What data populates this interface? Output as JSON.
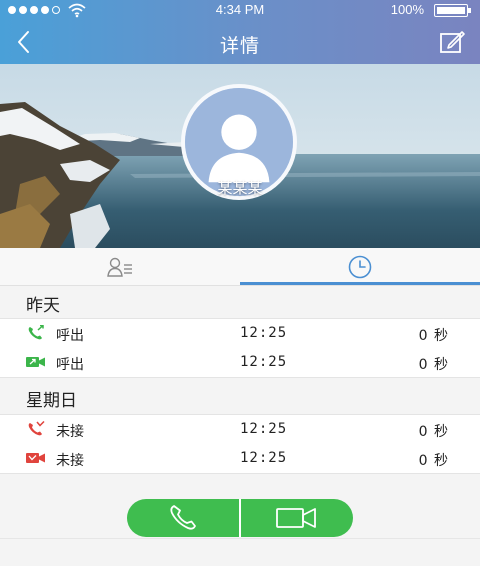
{
  "status_bar": {
    "time": "4:34 PM",
    "battery_text": "100%",
    "signal_bars_filled": 4,
    "signal_bars_total": 5
  },
  "nav": {
    "title": "详情",
    "back_icon": "chevron-left-icon",
    "edit_icon": "edit-icon"
  },
  "contact": {
    "name": "某某某"
  },
  "tabs": [
    {
      "id": "contact",
      "icon": "contact-card-icon",
      "active": false
    },
    {
      "id": "history",
      "icon": "clock-icon",
      "active": true
    }
  ],
  "sections": [
    {
      "title": "昨天",
      "items": [
        {
          "icon": "outgoing-call-icon",
          "type": "呼出",
          "time": "12:25",
          "duration": "0 秒",
          "color": "#3bb54a"
        },
        {
          "icon": "outgoing-video-icon",
          "type": "呼出",
          "time": "12:25",
          "duration": "0 秒",
          "color": "#3bb54a"
        }
      ]
    },
    {
      "title": "星期日",
      "items": [
        {
          "icon": "missed-call-icon",
          "type": "未接",
          "time": "12:25",
          "duration": "0 秒",
          "color": "#e0443d"
        },
        {
          "icon": "missed-video-icon",
          "type": "未接",
          "time": "12:25",
          "duration": "0 秒",
          "color": "#e0443d"
        }
      ]
    }
  ],
  "actions": {
    "voice_call_icon": "phone-icon",
    "video_call_icon": "video-camera-icon",
    "accent_color": "#3fbd4f"
  },
  "theme": {
    "header_gradient_start": "#4aa0d8",
    "header_gradient_end": "#7a84c0",
    "tab_active_color": "#4a8fd2"
  }
}
